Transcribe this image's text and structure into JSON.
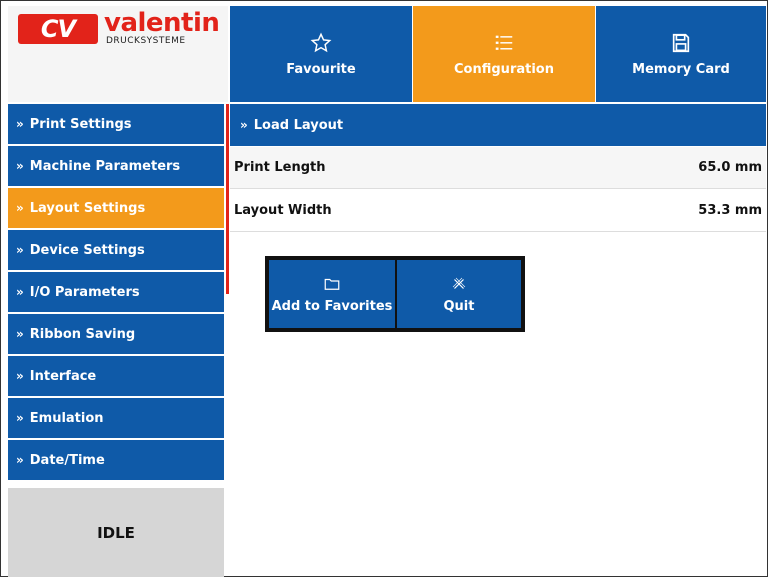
{
  "logo": {
    "mark": "CV",
    "name": "valentin",
    "subtitle": "DRUCKSYSTEME"
  },
  "top_nav": [
    {
      "label": "Favourite",
      "icon": "star-icon"
    },
    {
      "label": "Configuration",
      "icon": "list-icon",
      "active": true
    },
    {
      "label": "Memory Card",
      "icon": "save-icon"
    }
  ],
  "sidebar": {
    "items": [
      {
        "label": "Print Settings"
      },
      {
        "label": "Machine Parameters"
      },
      {
        "label": "Layout Settings",
        "active": true
      },
      {
        "label": "Device Settings"
      },
      {
        "label": "I/O Parameters"
      },
      {
        "label": "Ribbon Saving"
      },
      {
        "label": "Interface"
      },
      {
        "label": "Emulation"
      },
      {
        "label": "Date/Time"
      }
    ],
    "chevron": "»"
  },
  "status": {
    "text": "IDLE"
  },
  "main": {
    "header": "Load Layout",
    "rows": [
      {
        "label": "Print Length",
        "value": "65.0 mm"
      },
      {
        "label": "Layout Width",
        "value": "53.3 mm"
      }
    ]
  },
  "popup": {
    "add_label": "Add to Favorites",
    "quit_label": "Quit"
  },
  "colors": {
    "primary": "#0f5aa8",
    "accent": "#f39a1b",
    "brand_red": "#e2231a"
  }
}
